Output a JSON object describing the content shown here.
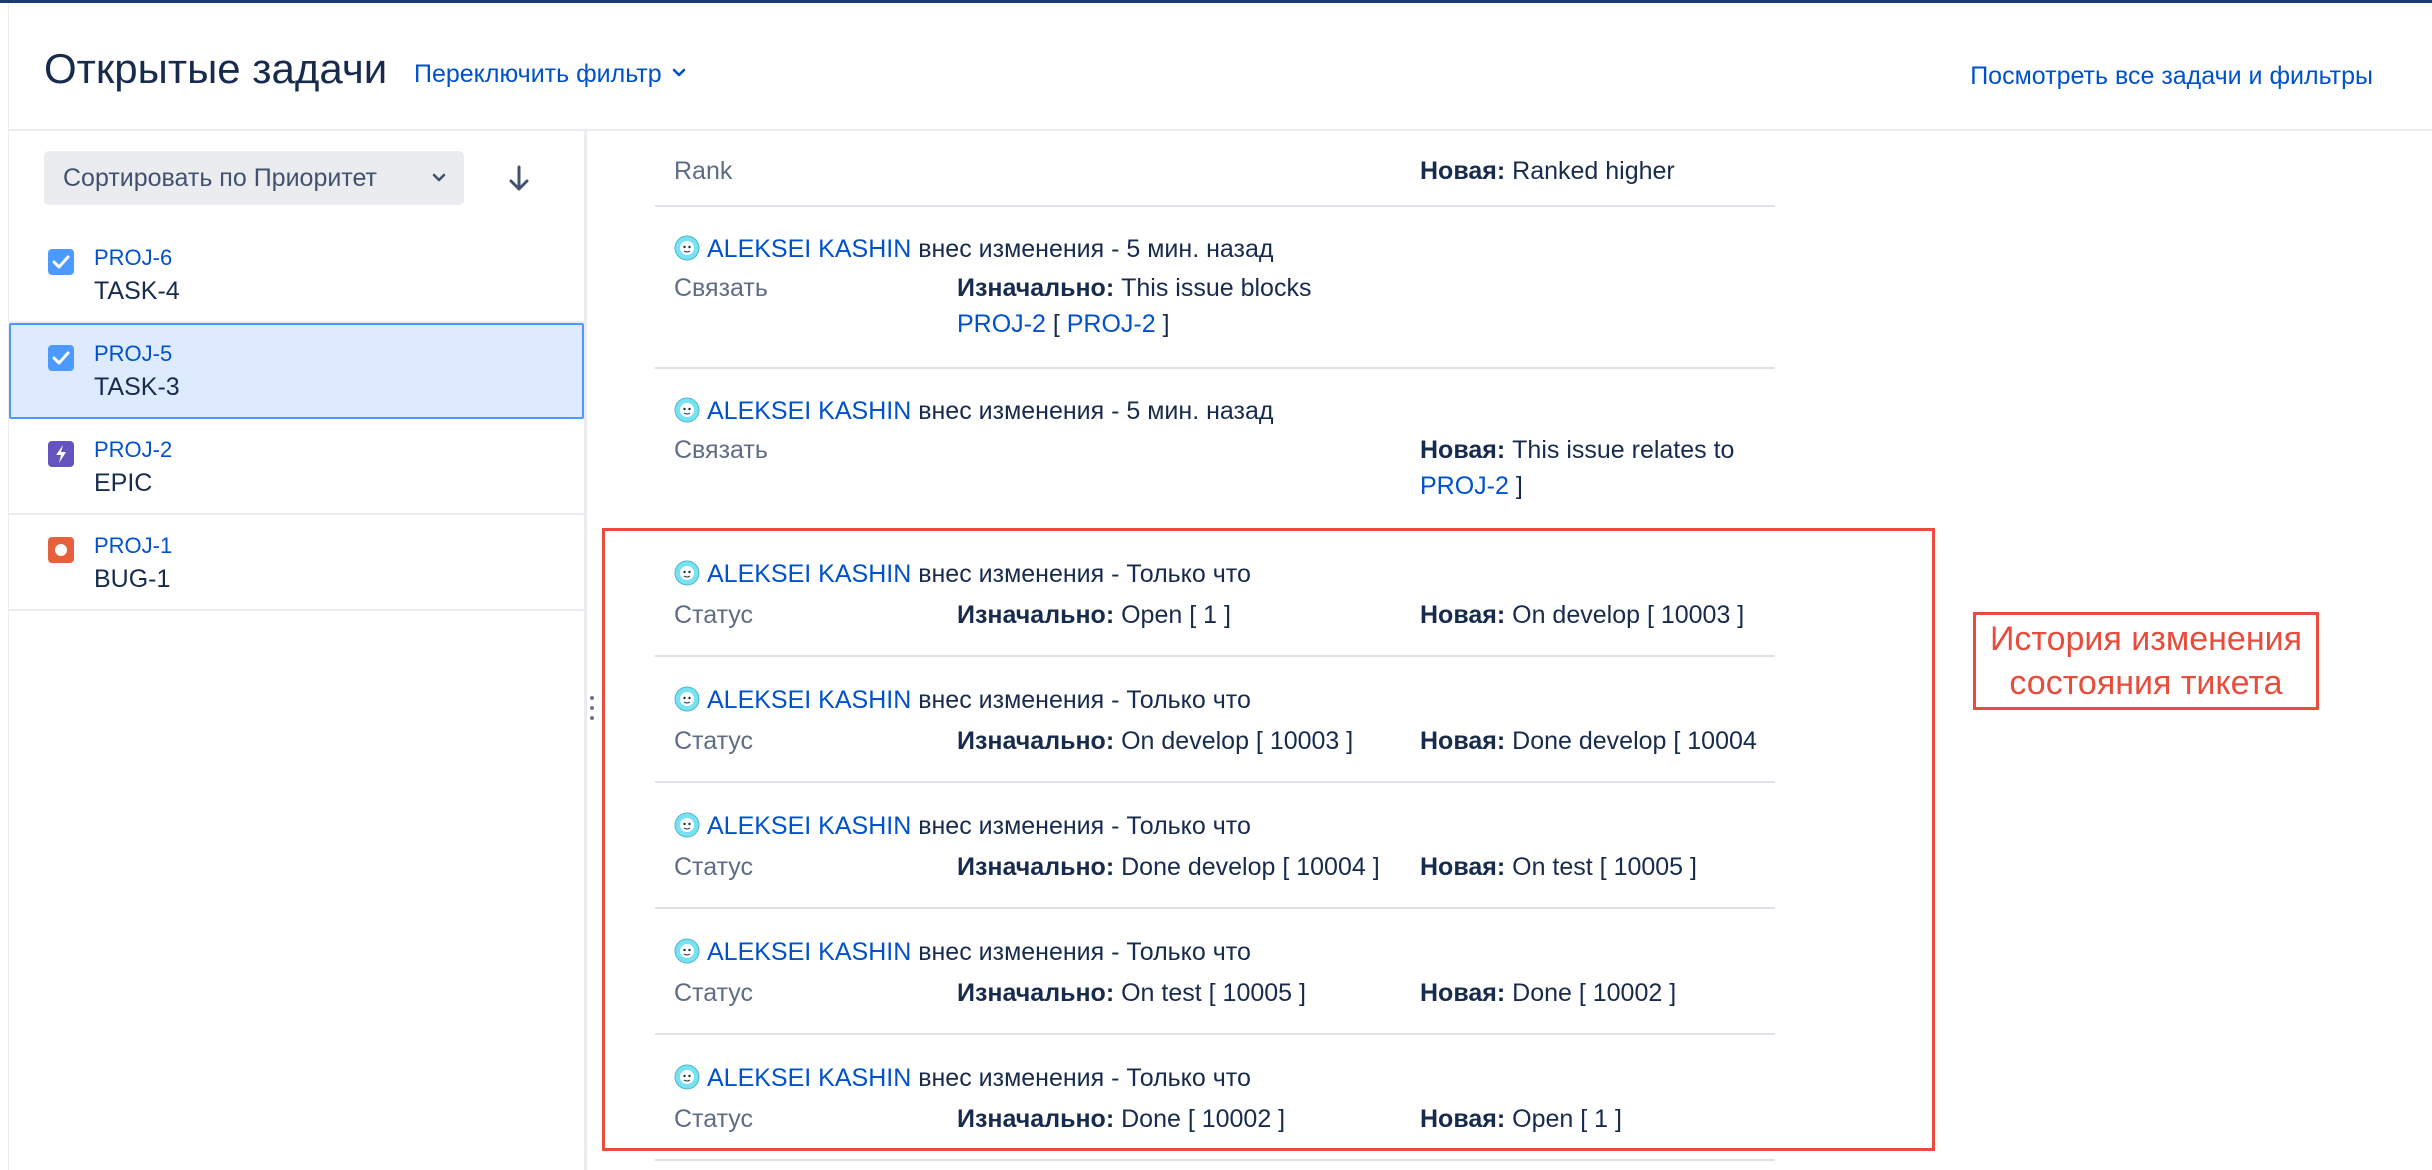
{
  "header": {
    "title": "Открытые задачи",
    "switch_filter": "Переключить фильтр",
    "view_all": "Посмотреть все задачи и фильтры"
  },
  "sidebar": {
    "sort_label": "Сортировать по Приоритет",
    "sort_direction_icon": "arrow-down-icon",
    "issues": [
      {
        "key": "PROJ-6",
        "summary": "TASK-4",
        "type_icon": "task-checkbox-icon",
        "color": "#4c9aff"
      },
      {
        "key": "PROJ-5",
        "summary": "TASK-3",
        "type_icon": "task-checkbox-icon",
        "color": "#4c9aff",
        "selected": true
      },
      {
        "key": "PROJ-2",
        "summary": "EPIC",
        "type_icon": "epic-lightning-icon",
        "color": "#6554c0"
      },
      {
        "key": "PROJ-1",
        "summary": "BUG-1",
        "type_icon": "bug-icon",
        "color": "#e5603b"
      }
    ]
  },
  "history": {
    "entries": [
      {
        "field": "Rank",
        "new_label": "Новая:",
        "new_value": "Ranked higher"
      },
      {
        "author": "ALEKSEI KASHIN",
        "action": "внес изменения - 5 мин. назад",
        "field": "Связать",
        "old_label": "Изначально:",
        "old_value": "This issue blocks",
        "old_link1": "PROJ-2",
        "old_link2": "PROJ-2"
      },
      {
        "author": "ALEKSEI KASHIN",
        "action": "внес изменения - 5 мин. назад",
        "field": "Связать",
        "new_label": "Новая:",
        "new_value": "This issue relates to",
        "new_link": "PROJ-2"
      },
      {
        "author": "ALEKSEI KASHIN",
        "action": "внес изменения - Только что",
        "field": "Статус",
        "old_label": "Изначально:",
        "old_value": "Open [ 1 ]",
        "new_label": "Новая:",
        "new_value": "On develop [ 10003 ]"
      },
      {
        "author": "ALEKSEI KASHIN",
        "action": "внес изменения - Только что",
        "field": "Статус",
        "old_label": "Изначально:",
        "old_value": "On develop [ 10003 ]",
        "new_label": "Новая:",
        "new_value": "Done develop [ 10004 ]"
      },
      {
        "author": "ALEKSEI KASHIN",
        "action": "внес изменения - Только что",
        "field": "Статус",
        "old_label": "Изначально:",
        "old_value": "Done develop [ 10004 ]",
        "new_label": "Новая:",
        "new_value": "On test [ 10005 ]"
      },
      {
        "author": "ALEKSEI KASHIN",
        "action": "внес изменения - Только что",
        "field": "Статус",
        "old_label": "Изначально:",
        "old_value": "On test [ 10005 ]",
        "new_label": "Новая:",
        "new_value": "Done [ 10002 ]"
      },
      {
        "author": "ALEKSEI KASHIN",
        "action": "внес изменения - Только что",
        "field": "Статус",
        "old_label": "Изначально:",
        "old_value": "Done [ 10002 ]",
        "new_label": "Новая:",
        "new_value": "Open [ 1 ]"
      }
    ]
  },
  "annotation": {
    "line1": "История изменения",
    "line2": "состояния тикета",
    "color": "#e74c3c"
  }
}
